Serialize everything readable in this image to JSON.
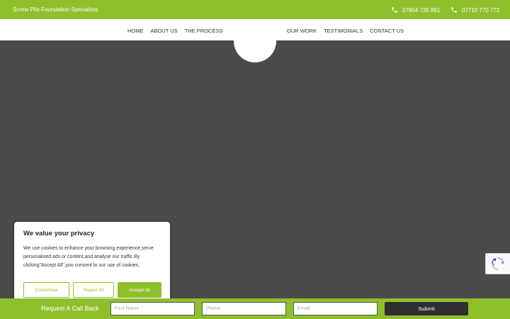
{
  "topbar": {
    "tagline": "Screw Pile Foundation Specialists",
    "phones": [
      "07804 735 881",
      "07710 770 772"
    ]
  },
  "nav": {
    "left": [
      "HOME",
      "ABOUT US",
      "THE PROCESS"
    ],
    "right": [
      "OUR WORK",
      "TESTIMONIALS",
      "CONTACT US"
    ]
  },
  "cookie": {
    "title": "We value your privacy",
    "body": "We use cookies to enhance your browsing experience,serve personalised ads or content,and analyse our traffic.By clicking\"Accept All\",you consent to our use of cookies.",
    "customise": "Customise",
    "reject": "Reject All",
    "accept": "Accept All"
  },
  "callback": {
    "label": "Request A Call Back",
    "first_name_placeholder": "First Name",
    "phone_placeholder": "Phone",
    "email_placeholder": "Email",
    "submit": "Submit"
  },
  "colors": {
    "brand_green": "#8fbf2b",
    "hero_bg": "#4b4b4b",
    "submit_bg": "#2f2f2f"
  },
  "icons": {
    "phone": "phone-icon",
    "recaptcha": "recaptcha-icon"
  }
}
